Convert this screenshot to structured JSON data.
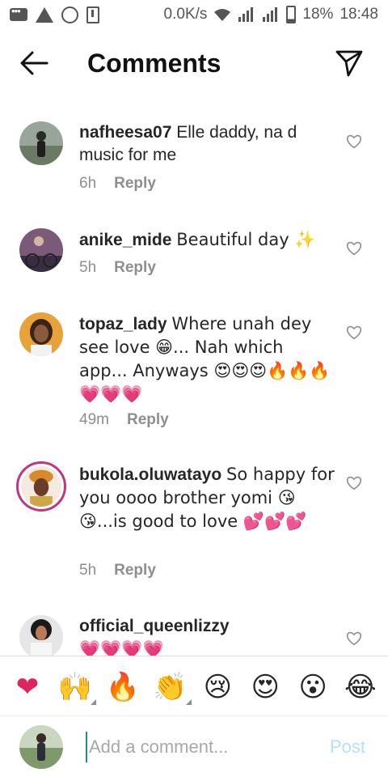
{
  "status_bar": {
    "speed": "0.0K/s",
    "battery": "18%",
    "time": "18:48"
  },
  "header": {
    "title": "Comments",
    "back_icon": "arrow-left-icon",
    "send_icon": "paper-plane-icon"
  },
  "comments": [
    {
      "username": "nafheesa07",
      "text": "Elle daddy, na d music for me",
      "time": "6h",
      "reply_label": "Reply"
    },
    {
      "username": "anike_mide",
      "text": "Beautiful day ✨",
      "time": "5h",
      "reply_label": "Reply"
    },
    {
      "username": "topaz_lady",
      "text": "Where unah dey see love 😁... Nah which app... Anyways 😍😍😍🔥🔥🔥💗💗💗",
      "time": "49m",
      "reply_label": "Reply"
    },
    {
      "username": "bukola.oluwatayo",
      "text": "So happy for you oooo brother yomi 😘😘...is good to love 💕💕💕",
      "time": "5h",
      "reply_label": "Reply"
    },
    {
      "username": "official_queenlizzy",
      "text": "💗💗💗💗"
    }
  ],
  "emoji_bar": [
    "❤",
    "🙌",
    "🔥",
    "👏",
    "😢",
    "😍",
    "😮",
    "😂"
  ],
  "input": {
    "placeholder": "Add a comment...",
    "post_label": "Post"
  },
  "colors": {
    "accent_link": "#b2dffc",
    "secondary_text": "#8e8e8e",
    "story_ring": "#c13584"
  }
}
